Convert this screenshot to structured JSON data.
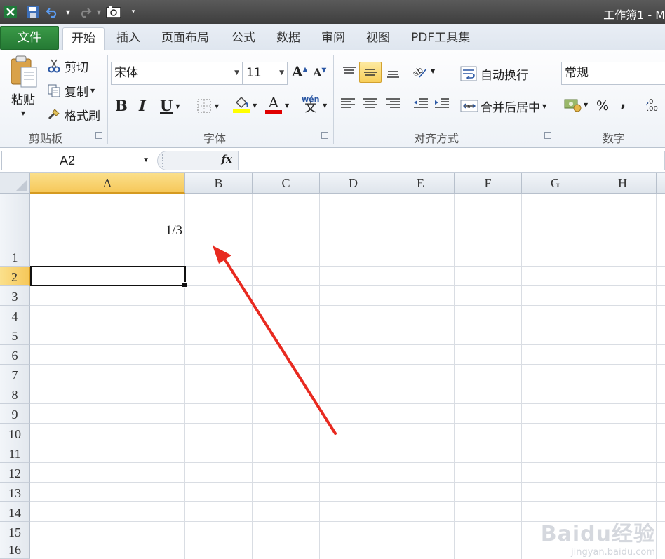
{
  "window": {
    "title": "工作簿1 - M"
  },
  "quick_access": {
    "icons": [
      "excel-logo-icon",
      "save-icon",
      "undo-icon",
      "redo-icon",
      "camera-icon",
      "customize-icon"
    ]
  },
  "tabs": [
    {
      "label": "文件"
    },
    {
      "label": "开始"
    },
    {
      "label": "插入"
    },
    {
      "label": "页面布局"
    },
    {
      "label": "公式"
    },
    {
      "label": "数据"
    },
    {
      "label": "审阅"
    },
    {
      "label": "视图"
    },
    {
      "label": "PDF工具集"
    }
  ],
  "clipboard": {
    "paste_label": "粘贴",
    "cut_label": "剪切",
    "copy_label": "复制",
    "format_painter_label": "格式刷",
    "group_label": "剪贴板"
  },
  "font": {
    "font_name": "宋体",
    "font_size": "11",
    "bold": "B",
    "italic": "I",
    "underline": "U",
    "group_label": "字体",
    "font_color": "#e00000",
    "fill_color": "#ffff00"
  },
  "alignment": {
    "wrap_text_label": "自动换行",
    "merge_center_label": "合并后居中",
    "group_label": "对齐方式"
  },
  "number": {
    "format": "常规",
    "percent": "%",
    "comma": ",",
    "group_label": "数字"
  },
  "formula_bar": {
    "name_box": "A2",
    "fx_label": "fx",
    "formula": ""
  },
  "sheet": {
    "columns": [
      "A",
      "B",
      "C",
      "D",
      "E",
      "F",
      "G",
      "H"
    ],
    "selected_column": "A",
    "rows": [
      "1",
      "2",
      "3",
      "4",
      "5",
      "6",
      "7",
      "8",
      "9",
      "10",
      "11",
      "12",
      "13",
      "14",
      "15",
      "16"
    ],
    "selected_row": "2",
    "cells": {
      "A1": "1/3"
    },
    "active_cell": "A2",
    "annotation_color": "#e82a20"
  },
  "watermark": {
    "brand": "Baidu经验",
    "url": "jingyan.baidu.com"
  }
}
